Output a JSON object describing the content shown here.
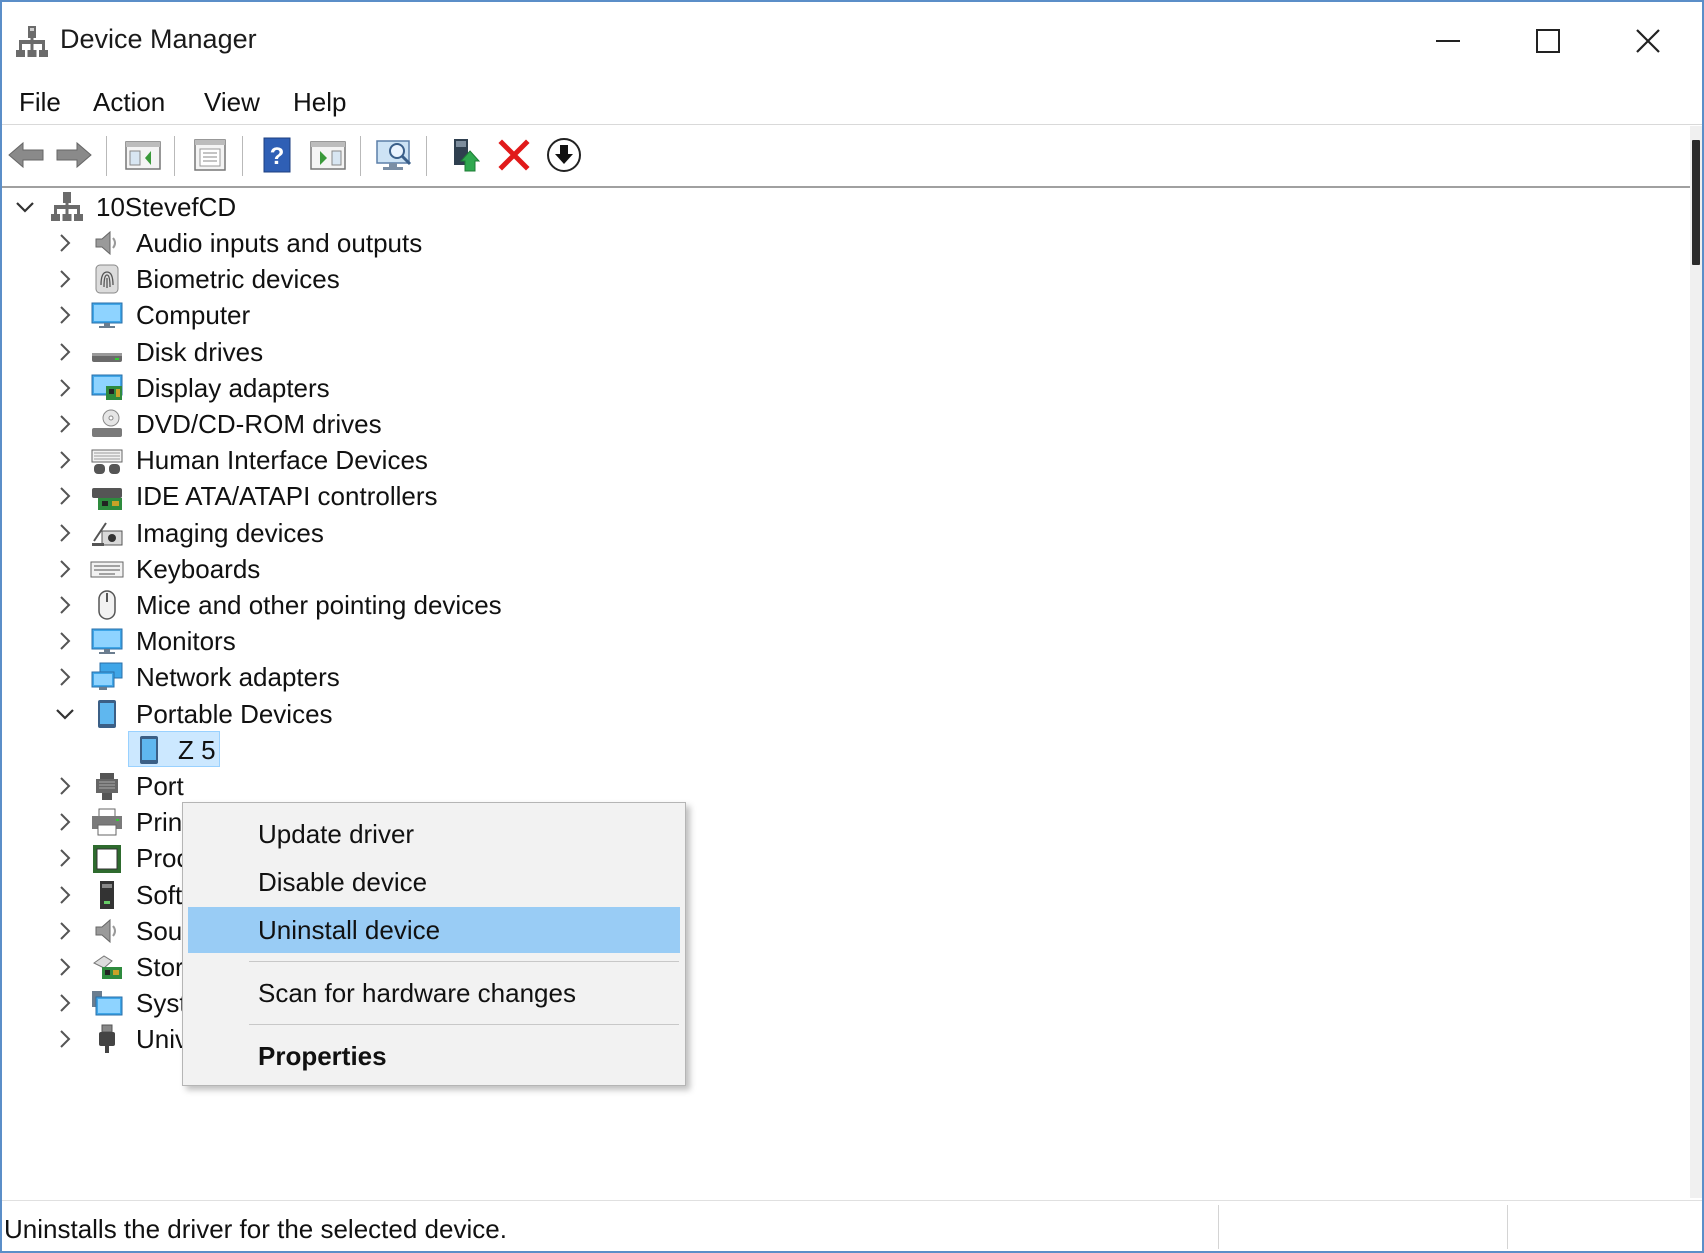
{
  "window": {
    "title": "Device Manager",
    "controls": [
      "minimize-icon",
      "maximize-icon",
      "close-icon"
    ]
  },
  "menu": [
    "File",
    "Action",
    "View",
    "Help"
  ],
  "toolbar": [
    "back-icon",
    "forward-icon",
    "show-hide-console-tree-icon",
    "properties-icon",
    "help-icon",
    "action-pane-icon",
    "scan-hardware-icon",
    "update-driver-icon",
    "uninstall-icon",
    "download-icon"
  ],
  "tree": {
    "root": "10StevefCD",
    "categories": [
      {
        "label": "Audio inputs and outputs",
        "icon": "speaker-icon"
      },
      {
        "label": "Biometric devices",
        "icon": "fingerprint-icon"
      },
      {
        "label": "Computer",
        "icon": "monitor-icon"
      },
      {
        "label": "Disk drives",
        "icon": "disk-drive-icon"
      },
      {
        "label": "Display adapters",
        "icon": "display-adapter-icon"
      },
      {
        "label": "DVD/CD-ROM drives",
        "icon": "dvd-drive-icon"
      },
      {
        "label": "Human Interface Devices",
        "icon": "hid-icon"
      },
      {
        "label": "IDE ATA/ATAPI controllers",
        "icon": "ide-controller-icon"
      },
      {
        "label": "Imaging devices",
        "icon": "camera-icon"
      },
      {
        "label": "Keyboards",
        "icon": "keyboard-icon"
      },
      {
        "label": "Mice and other pointing devices",
        "icon": "mouse-icon"
      },
      {
        "label": "Monitors",
        "icon": "monitor-icon"
      },
      {
        "label": "Network adapters",
        "icon": "network-icon"
      },
      {
        "label": "Portable Devices",
        "icon": "tablet-icon"
      },
      {
        "label": "Z 5",
        "icon": "tablet-icon"
      },
      {
        "label": "Port",
        "icon": "port-icon"
      },
      {
        "label": "Prin",
        "icon": "printer-icon"
      },
      {
        "label": "Proc",
        "icon": "processor-icon"
      },
      {
        "label": "Soft",
        "icon": "software-device-icon"
      },
      {
        "label": "Sou",
        "icon": "speaker-icon"
      },
      {
        "label": "Stor",
        "icon": "storage-icon"
      },
      {
        "label": "Syst",
        "icon": "system-icon"
      },
      {
        "label": "Universal Serial Bus controllers",
        "icon": "usb-icon"
      }
    ]
  },
  "context_menu": {
    "items": [
      "Update driver",
      "Disable device",
      "Uninstall device",
      "Scan for hardware changes",
      "Properties"
    ],
    "highlighted": "Uninstall device"
  },
  "status": {
    "text": "Uninstalls the driver for the selected device."
  }
}
